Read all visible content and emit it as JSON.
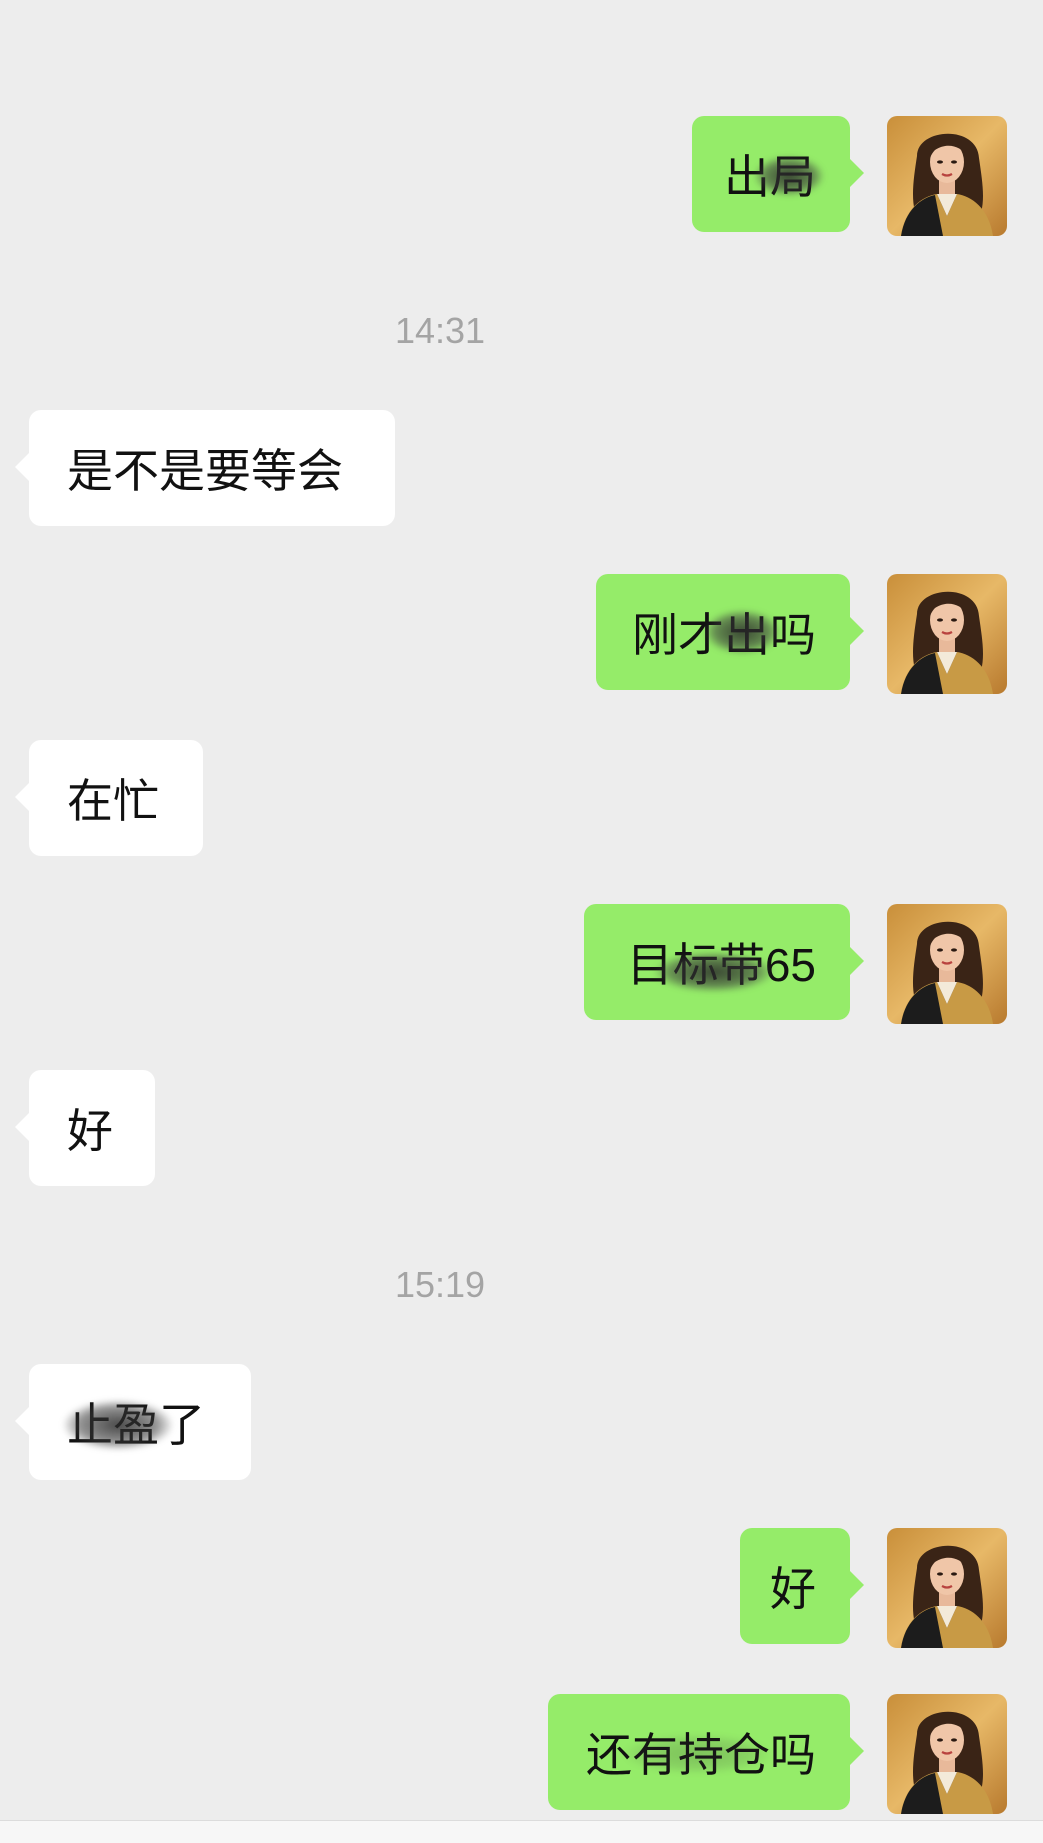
{
  "chat": {
    "timestamps": [
      "14:31",
      "15:19"
    ],
    "messages": [
      {
        "direction": "outgoing",
        "text": "出局"
      },
      {
        "direction": "incoming",
        "text": "是不是要等会"
      },
      {
        "direction": "outgoing",
        "text": "刚才出吗"
      },
      {
        "direction": "incoming",
        "text": "在忙"
      },
      {
        "direction": "outgoing",
        "text": "目标带65"
      },
      {
        "direction": "incoming",
        "text": "好"
      },
      {
        "direction": "incoming",
        "text": "止盈了"
      },
      {
        "direction": "outgoing",
        "text": "好"
      },
      {
        "direction": "outgoing",
        "text": "还有持仓吗"
      }
    ]
  },
  "colors": {
    "background": "#ededed",
    "incoming_bubble": "#ffffff",
    "outgoing_bubble": "#95ec69",
    "timestamp_text": "#a4a4a4"
  },
  "icons": {
    "avatar": "woman-portrait-avatar"
  }
}
